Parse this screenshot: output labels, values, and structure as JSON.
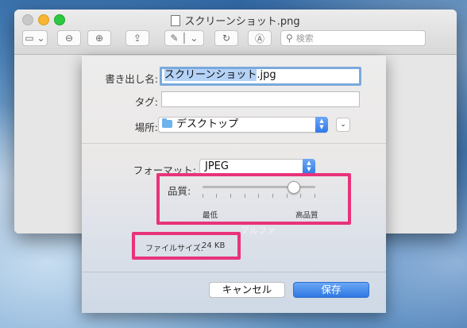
{
  "window": {
    "title": "スクリーンショット.png",
    "search_placeholder": "検索"
  },
  "toolbar": {
    "sidebar_icon": "sidebar-icon",
    "zoom_out_icon": "zoom-out-icon",
    "zoom_in_icon": "zoom-in-icon",
    "share_icon": "share-icon",
    "markup_icon": "markup-pen-icon",
    "rotate_icon": "rotate-icon",
    "annotate_icon": "annotate-icon"
  },
  "sheet": {
    "save_as_label": "書き出し名:",
    "save_as_value_selected": "スクリーンショット",
    "save_as_value_ext": ".jpg",
    "tags_label": "タグ:",
    "tags_value": "",
    "where_label": "場所:",
    "where_value": "デスクトップ",
    "format_label": "フォーマット:",
    "format_value": "JPEG",
    "quality_label": "品質:",
    "quality_min_label": "最低",
    "quality_max_label": "高品質",
    "quality_level": 0.8,
    "alpha_ghost_label": "アルファ",
    "file_size_label": "ファイルサイズ:",
    "file_size_value": "24 KB",
    "cancel_label": "キャンセル",
    "save_label": "保存"
  },
  "colors": {
    "highlight": "#e8337a",
    "accent": "#2f78e2"
  }
}
